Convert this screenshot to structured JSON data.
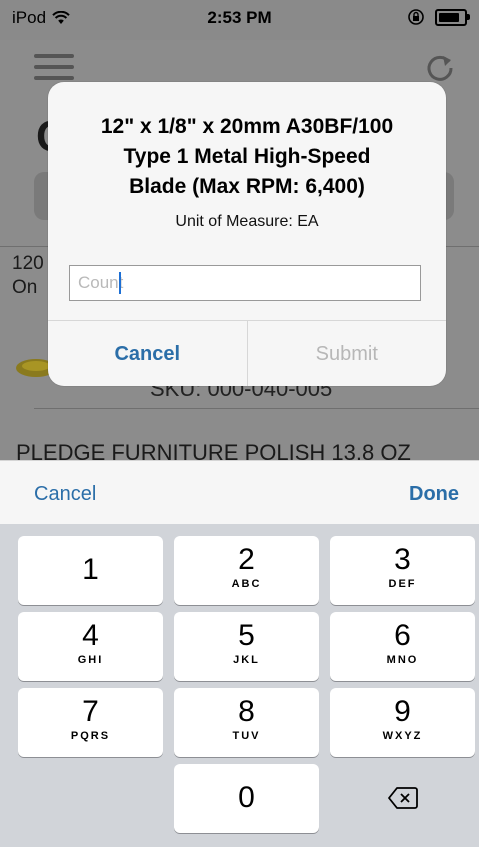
{
  "status_bar": {
    "device": "iPod",
    "time": "2:53 PM"
  },
  "background": {
    "title_initial": "C",
    "item1_text": "120 On",
    "item1_sku": "SKU: 000-040-005",
    "item2_text": "PLEDGE FURNITURE POLISH 13.8 OZ"
  },
  "alert": {
    "title_lines": [
      "12\" x 1/8\" x 20mm A30BF/100",
      "Type 1 Metal High-Speed",
      "Blade (Max RPM: 6,400)"
    ],
    "subtitle": "Unit of Measure: EA",
    "input_placeholder": "Count",
    "input_value": "",
    "cancel_label": "Cancel",
    "submit_label": "Submit"
  },
  "keyboard_toolbar": {
    "cancel_label": "Cancel",
    "done_label": "Done"
  },
  "keypad": {
    "keys": [
      {
        "digit": "1",
        "letters": ""
      },
      {
        "digit": "2",
        "letters": "ABC"
      },
      {
        "digit": "3",
        "letters": "DEF"
      },
      {
        "digit": "4",
        "letters": "GHI"
      },
      {
        "digit": "5",
        "letters": "JKL"
      },
      {
        "digit": "6",
        "letters": "MNO"
      },
      {
        "digit": "7",
        "letters": "PQRS"
      },
      {
        "digit": "8",
        "letters": "TUV"
      },
      {
        "digit": "9",
        "letters": "WXYZ"
      },
      {
        "digit": "0",
        "letters": ""
      }
    ]
  },
  "colors": {
    "accent": "#2b6ea8",
    "disabled": "#b7b7b7",
    "keypad_bg": "#d1d4d9",
    "dim_overlay": "#8c8c8c"
  }
}
